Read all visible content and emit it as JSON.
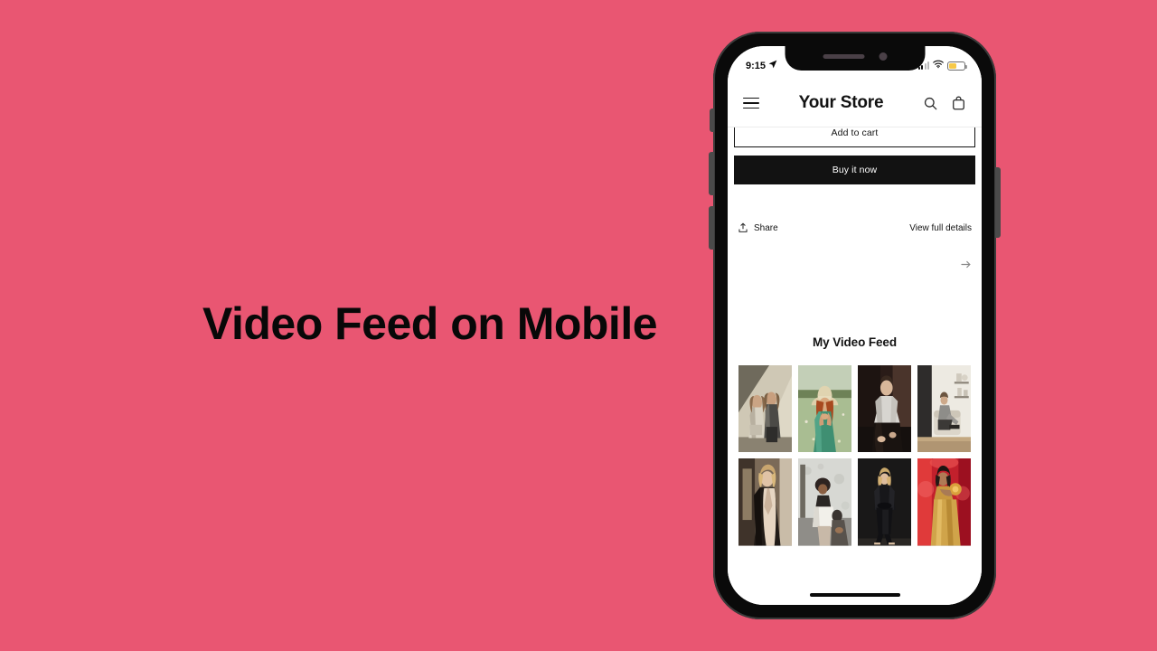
{
  "slide": {
    "headline": "Video Feed on Mobile",
    "background_color": "#e95672"
  },
  "phone": {
    "status_bar": {
      "time": "9:15",
      "location_icon": "location-arrow-icon",
      "signal_icon": "cellular-signal-icon",
      "wifi_icon": "wifi-icon",
      "battery_icon": "battery-low-power-icon",
      "battery_color": "#f7c948",
      "battery_level_percent": 52
    },
    "home_indicator": "home-indicator-bar"
  },
  "app": {
    "header": {
      "menu_icon": "hamburger-menu-icon",
      "title": "Your Store",
      "search_icon": "search-icon",
      "cart_icon": "shopping-bag-icon"
    },
    "product": {
      "add_to_cart_label": "Add to cart",
      "buy_now_label": "Buy it now",
      "share_label": "Share",
      "share_icon": "share-upload-icon",
      "view_details_label": "View full details",
      "carousel_next_icon": "arrow-right-icon"
    },
    "feed": {
      "title": "My Video Feed",
      "items": [
        {
          "name": "video-thumb-1",
          "alt": "two models in trench coats against sunlit wall"
        },
        {
          "name": "video-thumb-2",
          "alt": "woman in straw hat and green dress in flower field"
        },
        {
          "name": "video-thumb-3",
          "alt": "man in white shirt seated in dark room"
        },
        {
          "name": "video-thumb-4",
          "alt": "woman seated on sofa in bright interior"
        },
        {
          "name": "video-thumb-5",
          "alt": "woman in leather jacket by window light"
        },
        {
          "name": "video-thumb-6",
          "alt": "two people in white skirt and top on stairs"
        },
        {
          "name": "video-thumb-7",
          "alt": "woman in black suit on stool, dark studio"
        },
        {
          "name": "video-thumb-8",
          "alt": "woman in gold dress with red disco lighting"
        }
      ]
    }
  }
}
